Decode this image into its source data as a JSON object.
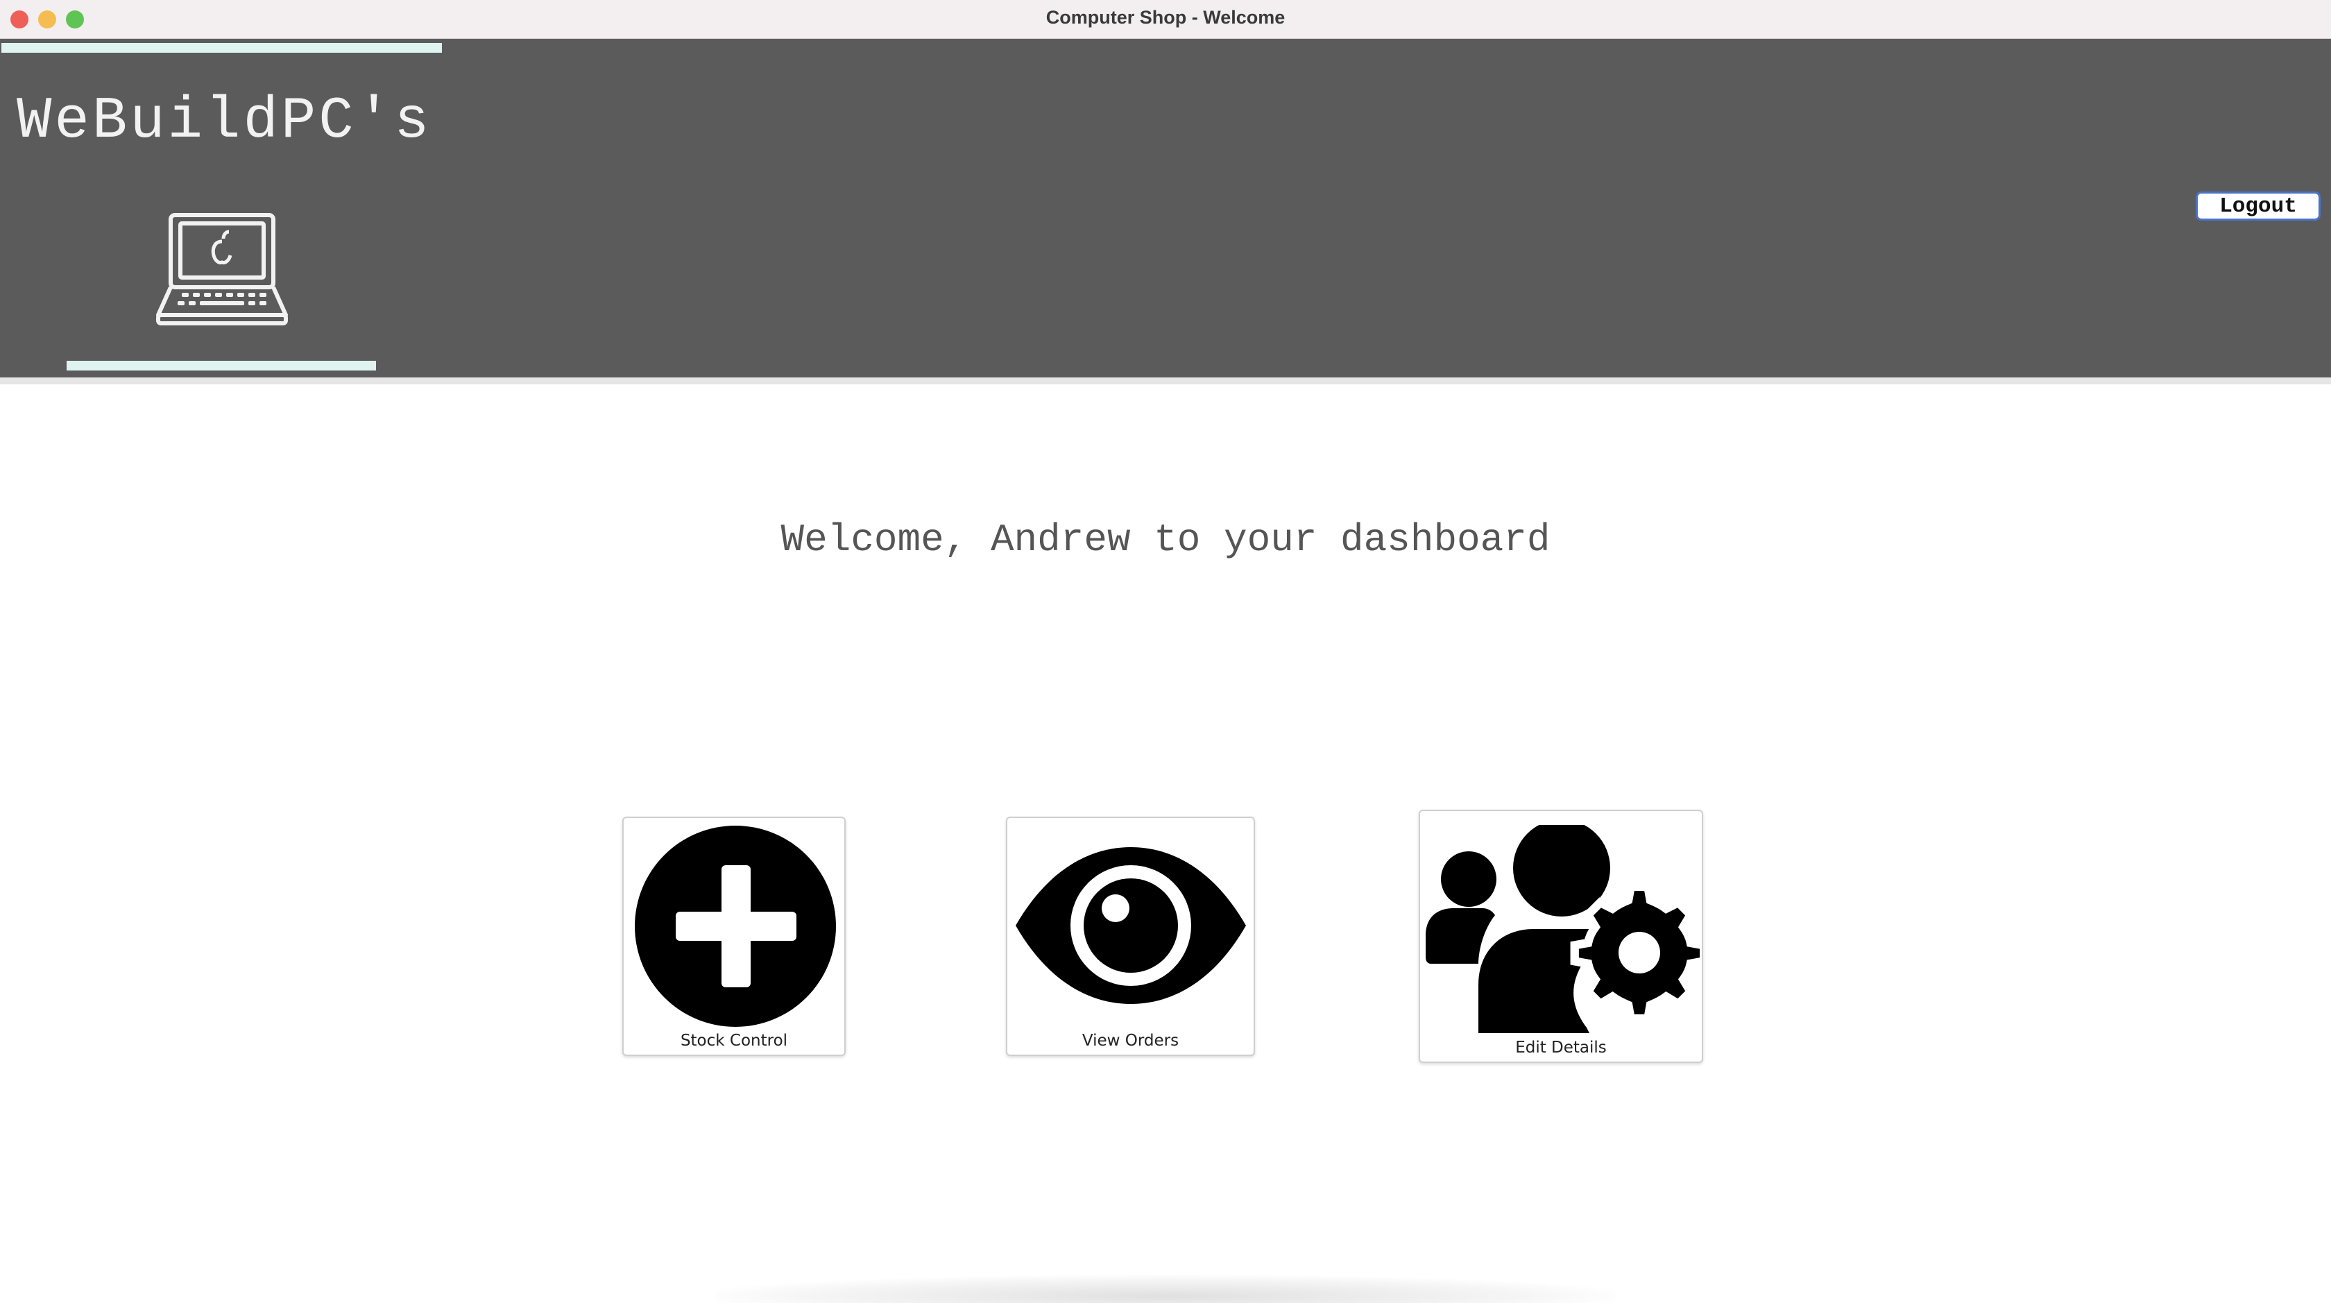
{
  "window": {
    "title": "Computer Shop - Welcome"
  },
  "header": {
    "brand": "WeBuildPC's",
    "logo_icon": "laptop-icon",
    "logout_label": "Logout"
  },
  "main": {
    "welcome_text": "Welcome, Andrew to your dashboard",
    "tiles": [
      {
        "label": "Stock Control",
        "icon": "plus-circle-icon"
      },
      {
        "label": "View Orders",
        "icon": "eye-icon"
      },
      {
        "label": "Edit Details",
        "icon": "users-gear-icon"
      }
    ]
  },
  "colors": {
    "header_bg": "#5b5b5b",
    "accent_bar": "#dff3f1",
    "button_border": "#4a74c9"
  }
}
